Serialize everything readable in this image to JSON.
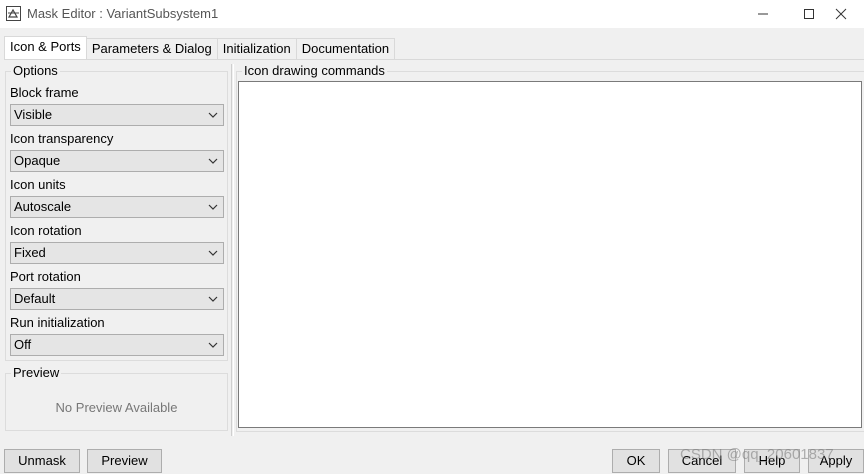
{
  "window": {
    "title": "Mask Editor : VariantSubsystem1"
  },
  "tabs": [
    {
      "label": "Icon & Ports",
      "active": true
    },
    {
      "label": "Parameters & Dialog",
      "active": false
    },
    {
      "label": "Initialization",
      "active": false
    },
    {
      "label": "Documentation",
      "active": false
    }
  ],
  "options": {
    "legend": "Options",
    "fields": [
      {
        "label": "Block frame",
        "value": "Visible"
      },
      {
        "label": "Icon transparency",
        "value": "Opaque"
      },
      {
        "label": "Icon units",
        "value": "Autoscale"
      },
      {
        "label": "Icon rotation",
        "value": "Fixed"
      },
      {
        "label": "Port rotation",
        "value": "Default"
      },
      {
        "label": "Run initialization",
        "value": "Off"
      }
    ]
  },
  "preview": {
    "legend": "Preview",
    "text": "No Preview Available"
  },
  "commands": {
    "legend": "Icon drawing commands",
    "value": ""
  },
  "buttons": {
    "unmask": "Unmask",
    "preview": "Preview",
    "ok": "OK",
    "cancel": "Cancel",
    "help": "Help",
    "apply": "Apply"
  },
  "watermark": "CSDN @qq_20601837"
}
